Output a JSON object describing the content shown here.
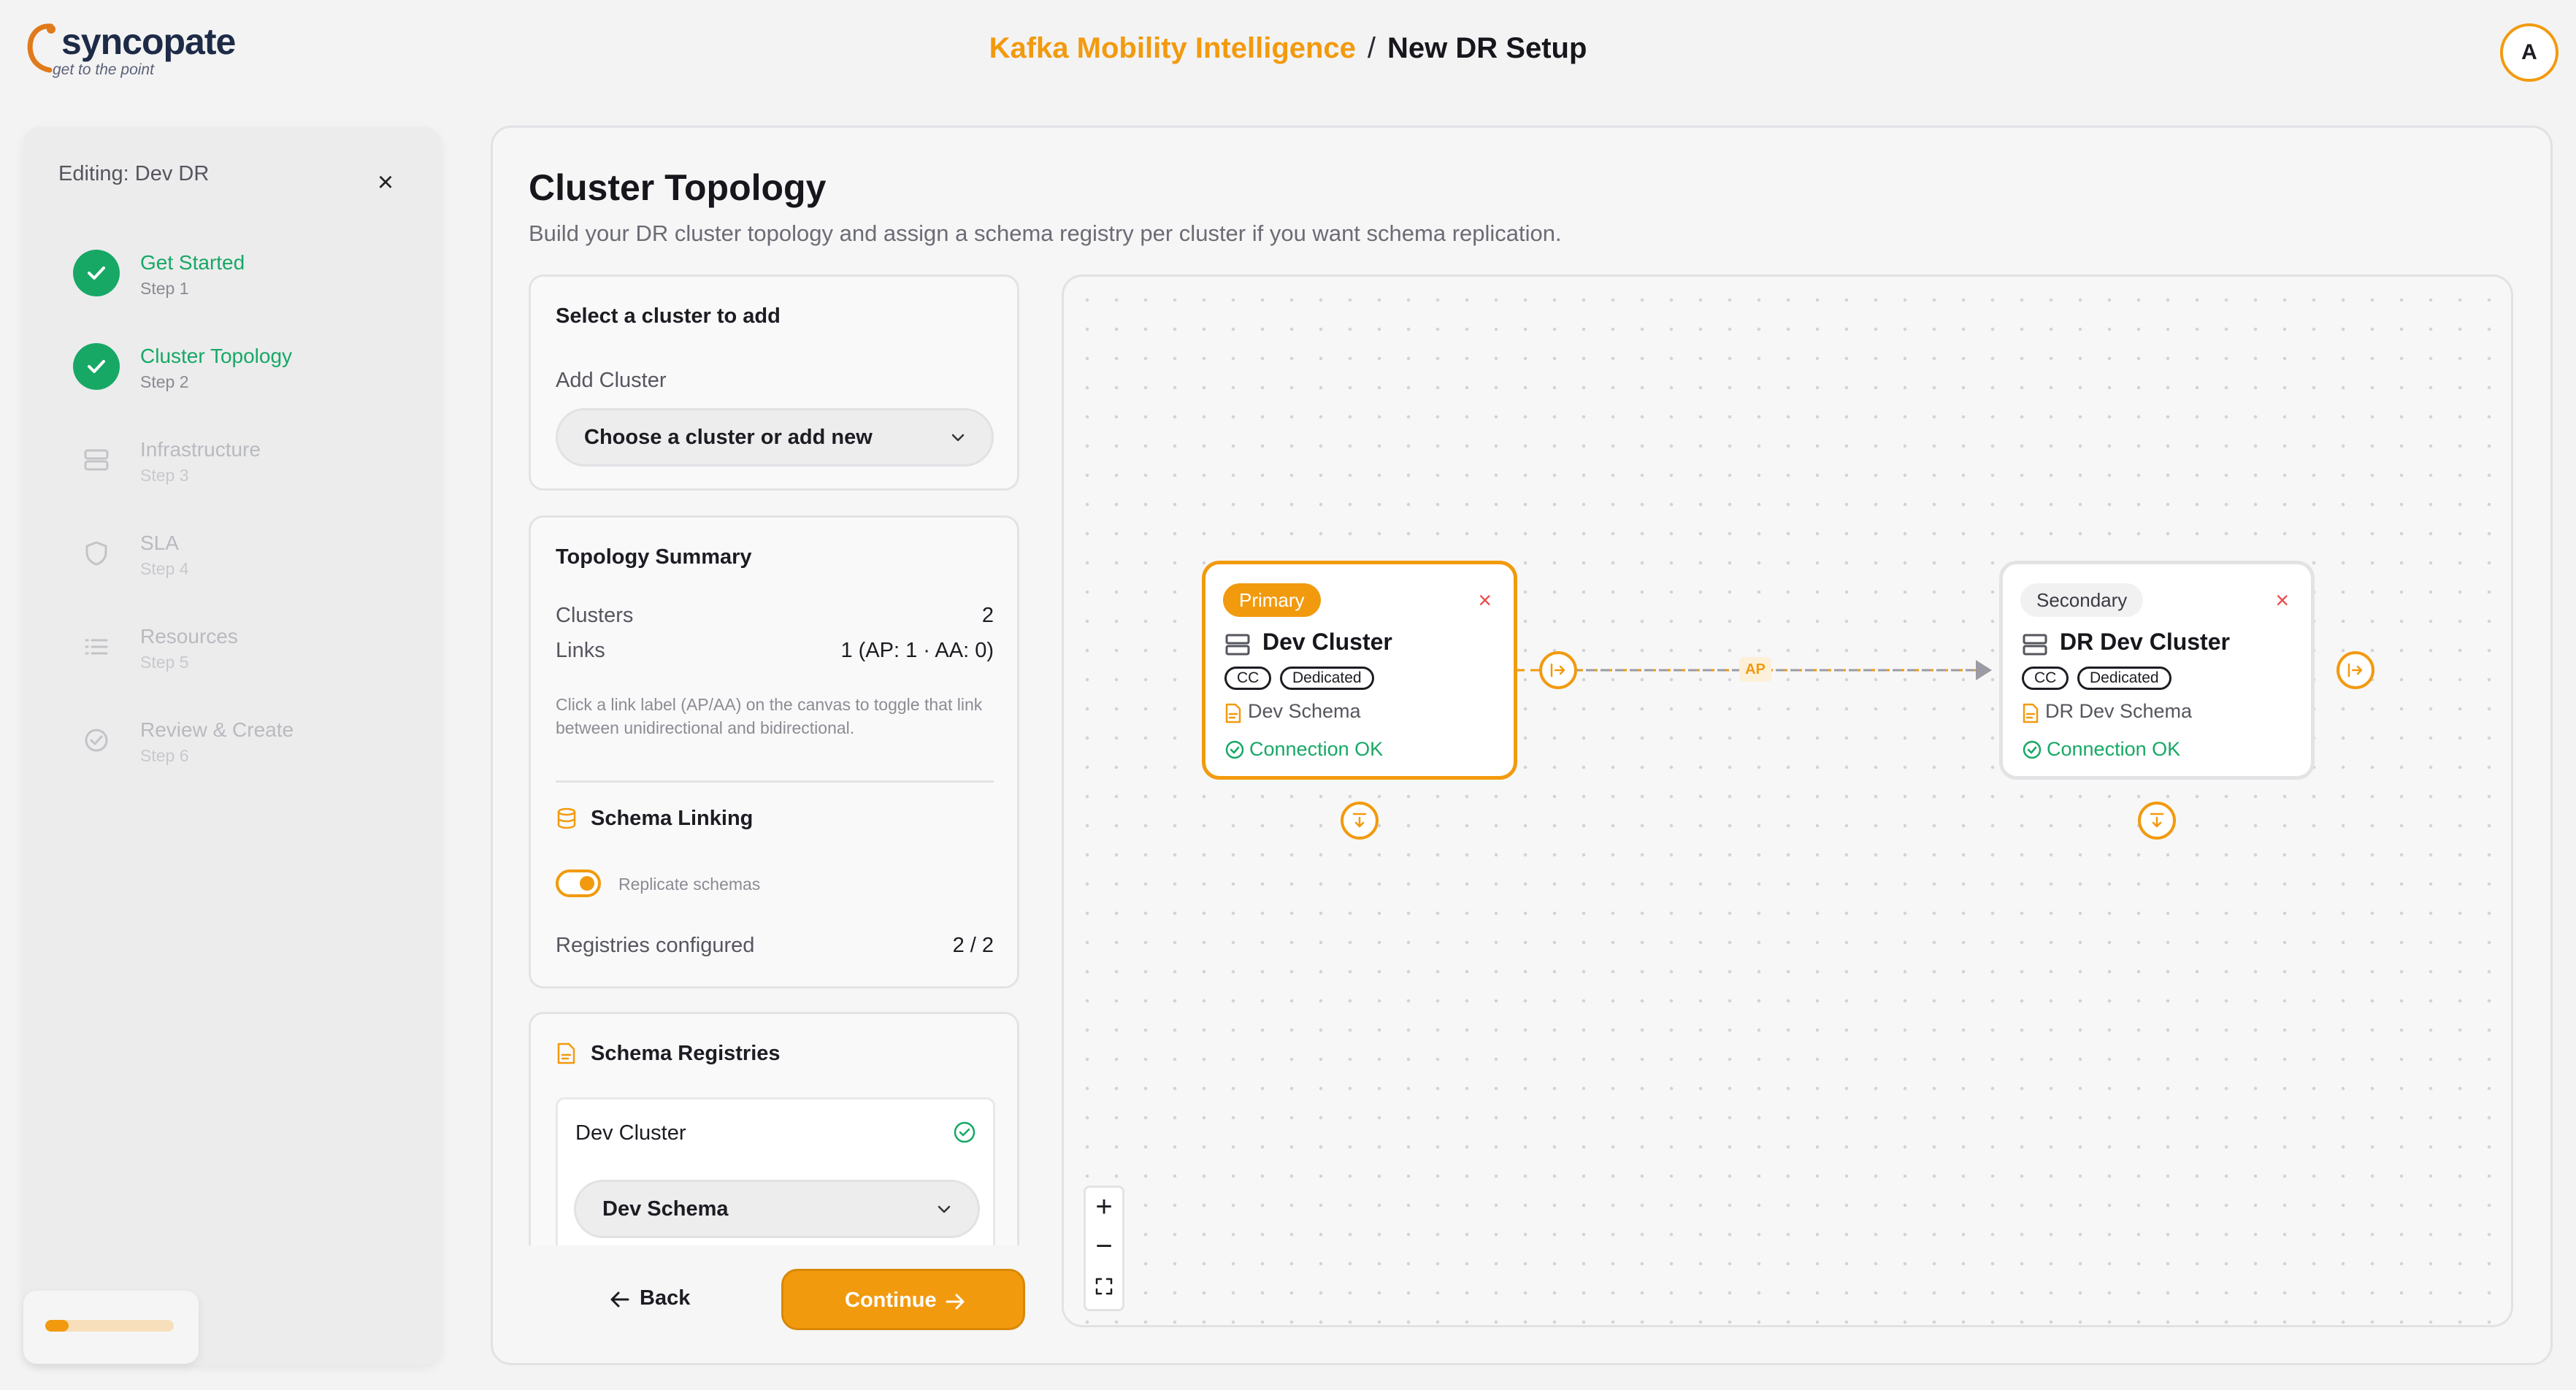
{
  "brand": {
    "name": "syncopate",
    "tagline": "get to the point"
  },
  "header": {
    "app": "Kafka Mobility Intelligence",
    "separator": "/",
    "page": "New DR Setup",
    "avatar": "A"
  },
  "sidebar": {
    "title": "Editing: Dev DR",
    "steps": [
      {
        "label": "Get Started",
        "sub": "Step 1",
        "state": "done",
        "icon": "check-icon"
      },
      {
        "label": "Cluster Topology",
        "sub": "Step 2",
        "state": "done",
        "icon": "check-icon"
      },
      {
        "label": "Infrastructure",
        "sub": "Step 3",
        "state": "todo",
        "icon": "server-icon"
      },
      {
        "label": "SLA",
        "sub": "Step 4",
        "state": "todo",
        "icon": "shield-icon"
      },
      {
        "label": "Resources",
        "sub": "Step 5",
        "state": "todo",
        "icon": "list-icon"
      },
      {
        "label": "Review & Create",
        "sub": "Step 6",
        "state": "todo",
        "icon": "check-circle-icon"
      }
    ],
    "progress": 0.18
  },
  "main": {
    "title": "Cluster Topology",
    "description": "Build your DR cluster topology and assign a schema registry per cluster if you want schema replication."
  },
  "select_card": {
    "title": "Select a cluster to add",
    "field_label": "Add Cluster",
    "placeholder": "Choose a cluster or add new"
  },
  "summary": {
    "title": "Topology Summary",
    "clusters_label": "Clusters",
    "clusters_value": "2",
    "links_label": "Links",
    "links_value": "1 (AP: 1 · AA: 0)",
    "help": "Click a link label (AP/AA) on the canvas to toggle that link between unidirectional and bidirectional.",
    "schema_linking_title": "Schema Linking",
    "replicate_label": "Replicate schemas",
    "replicate_on": true,
    "registries_label": "Registries configured",
    "registries_value": "2 / 2"
  },
  "registries": {
    "title": "Schema Registries",
    "items": [
      {
        "cluster": "Dev Cluster",
        "schema": "Dev Schema"
      }
    ]
  },
  "footer": {
    "back": "Back",
    "continue": "Continue"
  },
  "canvas": {
    "nodes": [
      {
        "role": "Primary",
        "name": "Dev Cluster",
        "tags": [
          "CC",
          "Dedicated"
        ],
        "schema": "Dev Schema",
        "status": "Connection OK"
      },
      {
        "role": "Secondary",
        "name": "DR Dev Cluster",
        "tags": [
          "CC",
          "Dedicated"
        ],
        "schema": "DR Dev Schema",
        "status": "Connection OK"
      }
    ],
    "link_label": "AP",
    "zoom_in": "+",
    "zoom_out": "−"
  },
  "colors": {
    "accent": "#f29a0e",
    "success": "#17a865",
    "danger": "#ea4b4b"
  }
}
